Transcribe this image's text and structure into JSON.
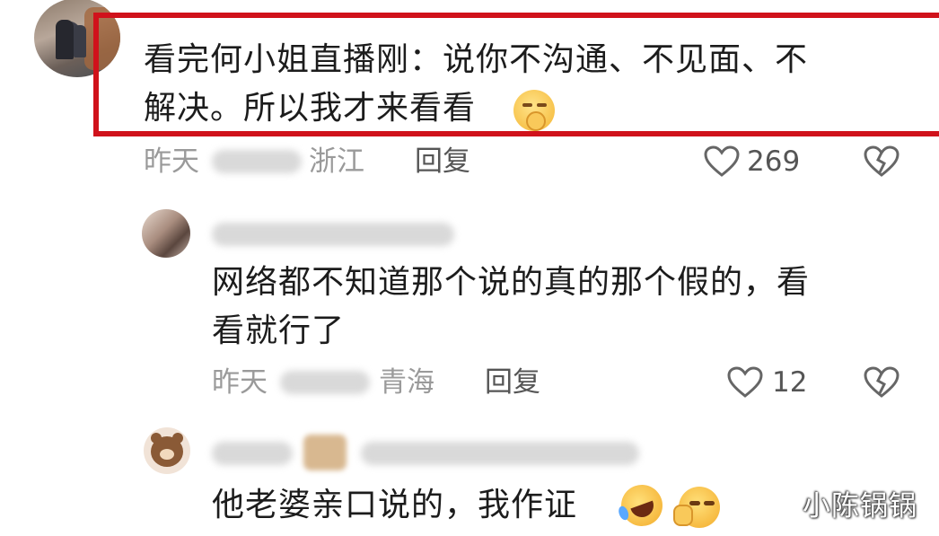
{
  "comments": [
    {
      "text_line1": "看完何小姐直播刚：说你不沟通、不见面、不",
      "text_line2": "解决。所以我才来看看",
      "emoji": "shushing-face-icon",
      "time": "昨天",
      "location": "浙江",
      "reply_label": "回复",
      "likes": "269"
    },
    {
      "text_line1": "网络都不知道那个说的真的那个假的，看",
      "text_line2": "看就行了",
      "time": "昨天",
      "location": "青海",
      "reply_label": "回复",
      "likes": "12"
    },
    {
      "text_line1": "他老婆亲口说的，我作证",
      "emojis": [
        "rolling-laughing-face-icon",
        "smirking-face-icon"
      ]
    }
  ],
  "highlight_color": "#d0121b",
  "watermark": "小陈锅锅"
}
